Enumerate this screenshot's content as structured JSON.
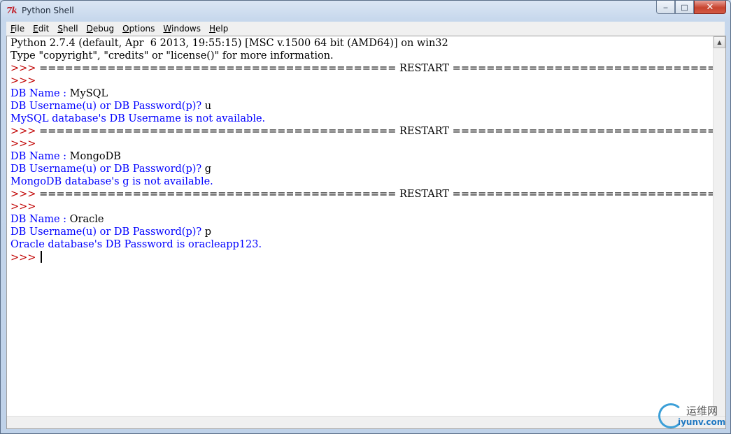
{
  "window": {
    "title": "Python Shell",
    "icon": "tk-feather-icon",
    "controls": {
      "minimize": "minimize-icon",
      "maximize": "maximize-icon",
      "close": "close-icon"
    }
  },
  "menu": [
    "File",
    "Edit",
    "Shell",
    "Debug",
    "Options",
    "Windows",
    "Help"
  ],
  "colors": {
    "stdout": "#000000",
    "prompt": "#c00000",
    "user_io": "#0000ff"
  },
  "shell": {
    "lines": [
      {
        "role": "stdout",
        "text": "Python 2.7.4 (default, Apr  6 2013, 19:55:15) [MSC v.1500 64 bit (AMD64)] on win32"
      },
      {
        "role": "stdout",
        "text": "Type \"copyright\", \"credits\" or \"license()\" for more information."
      },
      {
        "role": "restart",
        "prompt": ">>> ",
        "text": "========================================== RESTART =========================================="
      },
      {
        "role": "prompt",
        "prompt": ">>> ",
        "text": ""
      },
      {
        "role": "input",
        "label": "DB Name : ",
        "value": "MySQL"
      },
      {
        "role": "input",
        "label": "DB Username(u) or DB Password(p)? ",
        "value": "u"
      },
      {
        "role": "user",
        "text": "MySQL database's DB Username is not available."
      },
      {
        "role": "restart",
        "prompt": ">>> ",
        "text": "========================================== RESTART =========================================="
      },
      {
        "role": "prompt",
        "prompt": ">>> ",
        "text": ""
      },
      {
        "role": "input",
        "label": "DB Name : ",
        "value": "MongoDB"
      },
      {
        "role": "input",
        "label": "DB Username(u) or DB Password(p)? ",
        "value": "g"
      },
      {
        "role": "user",
        "text": "MongoDB database's g is not available."
      },
      {
        "role": "restart",
        "prompt": ">>> ",
        "text": "========================================== RESTART =========================================="
      },
      {
        "role": "prompt",
        "prompt": ">>> ",
        "text": ""
      },
      {
        "role": "input",
        "label": "DB Name : ",
        "value": "Oracle"
      },
      {
        "role": "input",
        "label": "DB Username(u) or DB Password(p)? ",
        "value": "p"
      },
      {
        "role": "user",
        "text": "Oracle database's DB Password is oracleapp123."
      },
      {
        "role": "active",
        "prompt": ">>> ",
        "text": ""
      }
    ]
  },
  "watermark": {
    "text": "运维网",
    "sub": "iyunv.com"
  }
}
